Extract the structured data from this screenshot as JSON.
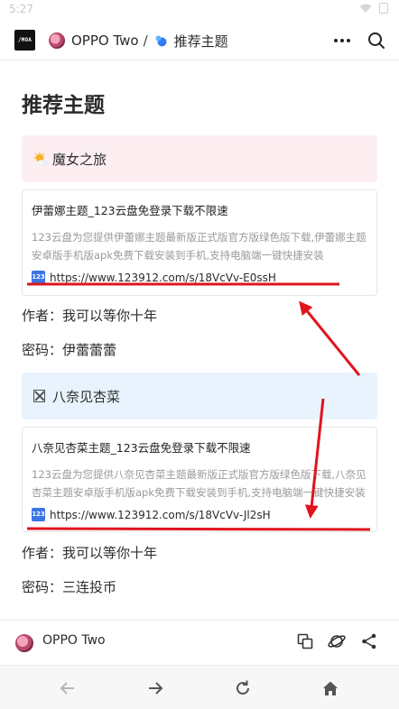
{
  "status": {
    "time": "5:27"
  },
  "header": {
    "logo_text": "/MOA",
    "workspace": "OPPO Two",
    "separator": "/",
    "page": "推荐主题"
  },
  "main": {
    "title": "推荐主题",
    "sections": [
      {
        "callout_icon": "sun-behind-cloud-icon",
        "callout_text": "魔女之旅",
        "color": "#fdeef2",
        "card": {
          "title": "伊蕾娜主题_123云盘免登录下载不限速",
          "description": "123云盘为您提供伊蕾娜主题最新版正式版官方版绿色版下载,伊蕾娜主题安卓版手机版apk免费下载安装到手机,支持电脑端一键快捷安装",
          "badge": "123",
          "url": "https://www.123912.com/s/18VcVv-E0ssH"
        },
        "author": "作者：我可以等你十年",
        "password": "密码：伊蕾蕾蕾"
      },
      {
        "callout_icon": "crossed-box-icon",
        "callout_text": "八奈见杏菜",
        "color": "#e8f3fd",
        "card": {
          "title": "八奈见杏菜主题_123云盘免登录下载不限速",
          "description": "123云盘为您提供八奈见杏菜主题最新版正式版官方版绿色版下载,八奈见杏菜主题安卓版手机版apk免费下载安装到手机,支持电脑端一键快捷安装",
          "badge": "123",
          "url": "https://www.123912.com/s/18VcVv-Jl2sH"
        },
        "author": "作者：我可以等你十年",
        "password": "密码：三连投币"
      }
    ]
  },
  "footer": {
    "name": "OPPO Two"
  },
  "annotation_color": "#e0141e"
}
